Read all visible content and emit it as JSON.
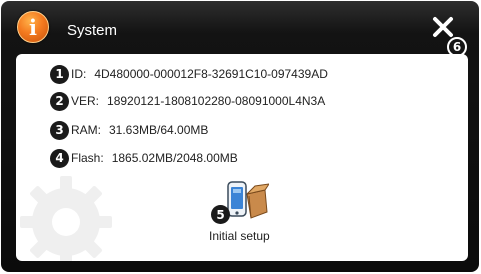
{
  "window": {
    "title": "System",
    "title_icon": "info-icon",
    "close_icon": "close-icon",
    "close_badge": "6"
  },
  "info": [
    {
      "badge": "1",
      "label": "ID:",
      "value": "4D480000-000012F8-32691C10-097439AD"
    },
    {
      "badge": "2",
      "label": "VER:",
      "value": "18920121-1808102280-08091000L4N3A"
    },
    {
      "badge": "3",
      "label": "RAM:",
      "value": "31.63MB/64.00MB"
    },
    {
      "badge": "4",
      "label": "Flash:",
      "value": "1865.02MB/2048.00MB"
    }
  ],
  "setup": {
    "badge": "5",
    "label": "Initial setup",
    "icon": "device-box-icon"
  },
  "colors": {
    "accent_orange": "#f47a1f",
    "window_dark": "#0b0b0b",
    "panel": "#ffffff"
  }
}
